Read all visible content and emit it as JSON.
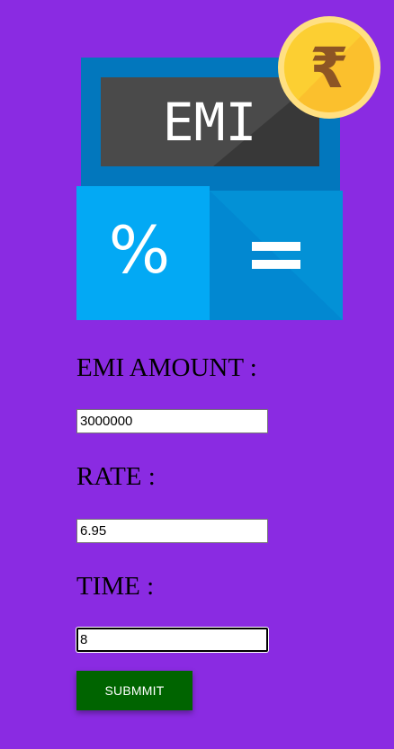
{
  "logo": {
    "screen_text": "EMI",
    "percent_symbol": "%",
    "equals_symbol": "=",
    "coin_symbol": "₹"
  },
  "fields": [
    {
      "label": "EMI AMOUNT :",
      "value": "3000000"
    },
    {
      "label": "RATE :",
      "value": "6.95"
    },
    {
      "label": "TIME :",
      "value": "8"
    }
  ],
  "submit_label": "SUBMMIT"
}
